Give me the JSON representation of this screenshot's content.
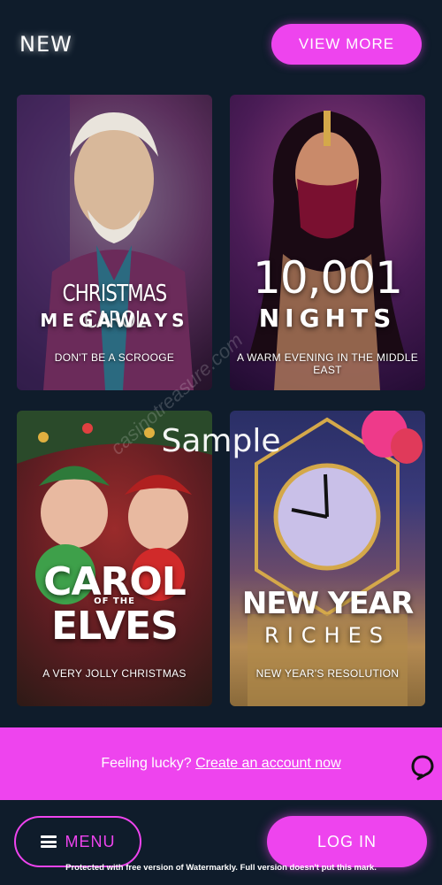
{
  "header": {
    "title": "NEW",
    "view_more_label": "VIEW MORE"
  },
  "games": [
    {
      "title_line1": "CHRISTMAS CAROL",
      "title_line2": "MEGAWAYS",
      "subtitle": "DON'T BE A SCROOGE"
    },
    {
      "title_line1": "10,001",
      "title_line2": "NIGHTS",
      "subtitle": "A WARM EVENING IN THE MIDDLE EAST"
    },
    {
      "title_line1": "CAROL",
      "title_small": "OF THE",
      "title_line2": "ELVES",
      "subtitle": "A VERY JOLLY CHRISTMAS"
    },
    {
      "title_line1": "NEW YEAR",
      "title_line2": "RICHES",
      "subtitle": "NEW YEAR'S RESOLUTION"
    }
  ],
  "promo": {
    "text": "Feeling lucky? ",
    "link_label": "Create an account now"
  },
  "footer": {
    "menu_label": "MENU",
    "login_label": "LOG IN"
  },
  "watermark": {
    "sample": "Sample",
    "diagonal": "casinotreasure.com",
    "notice": "Protected with free version of Watermarkly. Full version doesn't put this mark."
  },
  "icons": {
    "chat": "chat-bubble-icon",
    "menu": "hamburger-icon"
  },
  "colors": {
    "background": "#0f1c2b",
    "accent": "#ee44ee"
  }
}
